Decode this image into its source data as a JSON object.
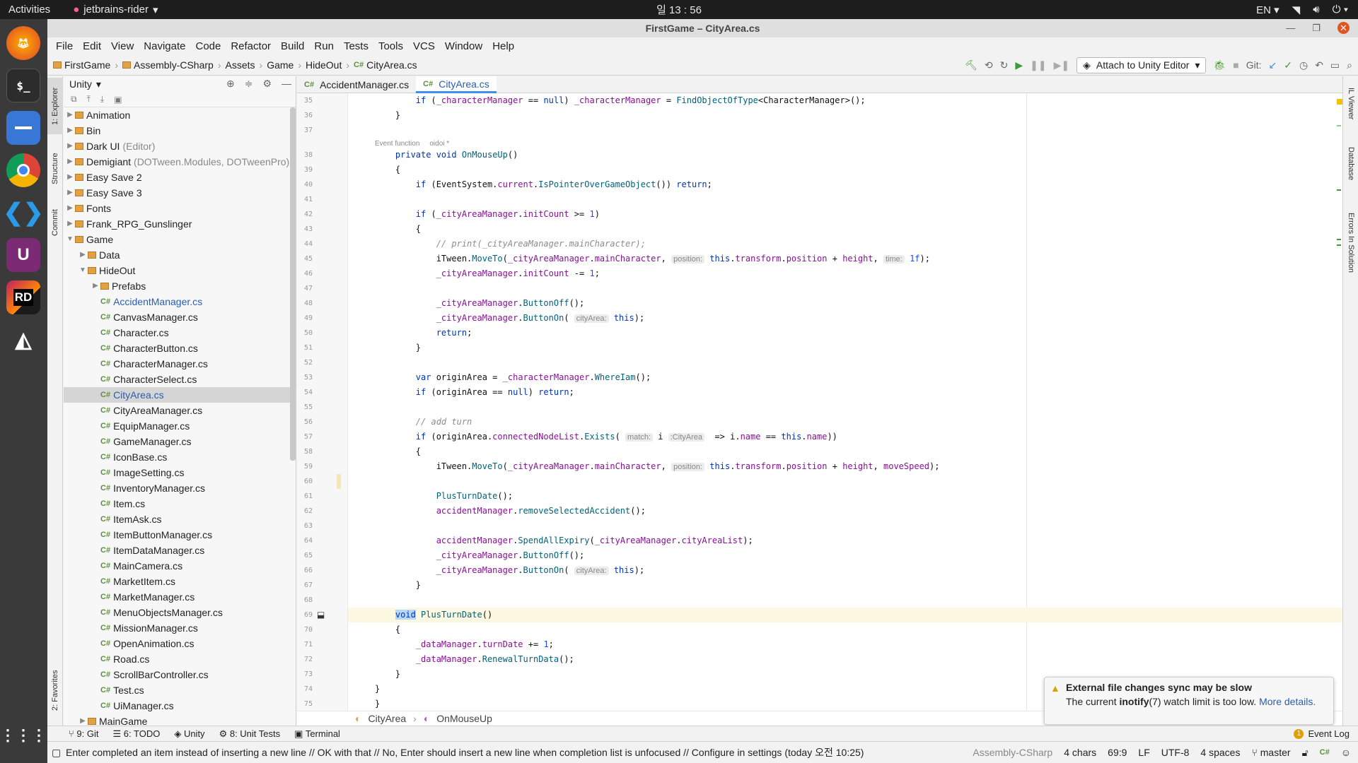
{
  "system": {
    "activities": "Activities",
    "app_name": "jetbrains-rider",
    "clock": "일 13 : 56",
    "lang": "EN"
  },
  "window": {
    "title": "FirstGame – CityArea.cs"
  },
  "menu": [
    "File",
    "Edit",
    "View",
    "Navigate",
    "Code",
    "Refactor",
    "Build",
    "Run",
    "Tests",
    "Tools",
    "VCS",
    "Window",
    "Help"
  ],
  "breadcrumb": [
    "FirstGame",
    "Assembly-CSharp",
    "Assets",
    "Game",
    "HideOut",
    "CityArea.cs"
  ],
  "toolbar": {
    "attach": "Attach to Unity Editor",
    "git": "Git:"
  },
  "left_tabs": [
    "1: Explorer",
    "Structure",
    "Commit",
    "2: Favorites"
  ],
  "right_tabs": [
    "IL Viewer",
    "Database",
    "Errors In Solution"
  ],
  "explorer": {
    "title": "Unity",
    "rows": [
      {
        "t": "Animation",
        "d": 0,
        "type": "folder",
        "arrow": "▶"
      },
      {
        "t": "Bin",
        "d": 0,
        "type": "folder",
        "arrow": "▶"
      },
      {
        "t": "Dark UI",
        "extra": "(Editor)",
        "d": 0,
        "type": "folder",
        "arrow": "▶"
      },
      {
        "t": "Demigiant",
        "extra": "(DOTween.Modules, DOTweenPro)",
        "d": 0,
        "type": "folder",
        "arrow": "▶"
      },
      {
        "t": "Easy Save 2",
        "d": 0,
        "type": "folder",
        "arrow": "▶"
      },
      {
        "t": "Easy Save 3",
        "d": 0,
        "type": "folder",
        "arrow": "▶"
      },
      {
        "t": "Fonts",
        "d": 0,
        "type": "folder",
        "arrow": "▶"
      },
      {
        "t": "Frank_RPG_Gunslinger",
        "d": 0,
        "type": "folder",
        "arrow": "▶"
      },
      {
        "t": "Game",
        "d": 0,
        "type": "folder",
        "arrow": "▼"
      },
      {
        "t": "Data",
        "d": 1,
        "type": "folder",
        "arrow": "▶"
      },
      {
        "t": "HideOut",
        "d": 1,
        "type": "folder",
        "arrow": "▼"
      },
      {
        "t": "Prefabs",
        "d": 2,
        "type": "folder",
        "arrow": "▶"
      },
      {
        "t": "AccidentManager.cs",
        "d": 2,
        "type": "cs",
        "blue": true
      },
      {
        "t": "CanvasManager.cs",
        "d": 2,
        "type": "cs"
      },
      {
        "t": "Character.cs",
        "d": 2,
        "type": "cs"
      },
      {
        "t": "CharacterButton.cs",
        "d": 2,
        "type": "cs"
      },
      {
        "t": "CharacterManager.cs",
        "d": 2,
        "type": "cs"
      },
      {
        "t": "CharacterSelect.cs",
        "d": 2,
        "type": "cs"
      },
      {
        "t": "CityArea.cs",
        "d": 2,
        "type": "cs",
        "blue": true,
        "selected": true
      },
      {
        "t": "CityAreaManager.cs",
        "d": 2,
        "type": "cs"
      },
      {
        "t": "EquipManager.cs",
        "d": 2,
        "type": "cs"
      },
      {
        "t": "GameManager.cs",
        "d": 2,
        "type": "cs"
      },
      {
        "t": "IconBase.cs",
        "d": 2,
        "type": "cs"
      },
      {
        "t": "ImageSetting.cs",
        "d": 2,
        "type": "cs"
      },
      {
        "t": "InventoryManager.cs",
        "d": 2,
        "type": "cs"
      },
      {
        "t": "Item.cs",
        "d": 2,
        "type": "cs"
      },
      {
        "t": "ItemAsk.cs",
        "d": 2,
        "type": "cs"
      },
      {
        "t": "ItemButtonManager.cs",
        "d": 2,
        "type": "cs"
      },
      {
        "t": "ItemDataManager.cs",
        "d": 2,
        "type": "cs"
      },
      {
        "t": "MainCamera.cs",
        "d": 2,
        "type": "cs"
      },
      {
        "t": "MarketItem.cs",
        "d": 2,
        "type": "cs"
      },
      {
        "t": "MarketManager.cs",
        "d": 2,
        "type": "cs"
      },
      {
        "t": "MenuObjectsManager.cs",
        "d": 2,
        "type": "cs"
      },
      {
        "t": "MissionManager.cs",
        "d": 2,
        "type": "cs"
      },
      {
        "t": "OpenAnimation.cs",
        "d": 2,
        "type": "cs"
      },
      {
        "t": "Road.cs",
        "d": 2,
        "type": "cs"
      },
      {
        "t": "ScrollBarController.cs",
        "d": 2,
        "type": "cs"
      },
      {
        "t": "Test.cs",
        "d": 2,
        "type": "cs"
      },
      {
        "t": "UiManager.cs",
        "d": 2,
        "type": "cs"
      },
      {
        "t": "MainGame",
        "d": 1,
        "type": "folder",
        "arrow": "▶"
      }
    ]
  },
  "tabs": [
    {
      "label": "AccidentManager.cs",
      "active": false
    },
    {
      "label": "CityArea.cs",
      "active": true
    }
  ],
  "code_hints": {
    "usage": "Event function",
    "author": "oidoi *"
  },
  "code": [
    {
      "n": "35",
      "h": "        <span class='kw'>if</span> (<span class='mem'>_characterManager</span> == <span class='kw'>null</span>) <span class='mem'>_characterManager</span> = <span class='fn'>FindObjectOfType</span>&lt;CharacterManager&gt;();"
    },
    {
      "n": "36",
      "h": "    }"
    },
    {
      "n": "37",
      "h": ""
    },
    {
      "n": "38",
      "h": "    <span class='kw'>private void</span> <span class='fn'>OnMouseUp</span>()"
    },
    {
      "n": "39",
      "h": "    {"
    },
    {
      "n": "40",
      "h": "        <span class='kw'>if</span> (EventSystem.<span class='mem'>current</span>.<span class='fn'>IsPointerOverGameObject</span>()) <span class='kw'>return</span>;"
    },
    {
      "n": "41",
      "h": ""
    },
    {
      "n": "42",
      "h": "        <span class='kw'>if</span> (<span class='mem'>_cityAreaManager</span>.<span class='mem'>initCount</span> &gt;= <span class='num'>1</span>)"
    },
    {
      "n": "43",
      "h": "        {"
    },
    {
      "n": "44",
      "h": "            <span class='cm'>// print(_cityAreaManager.mainCharacter);</span>"
    },
    {
      "n": "45",
      "h": "            iTween.<span class='fn'>MoveTo</span>(<span class='mem'>_cityAreaManager</span>.<span class='mem'>mainCharacter</span>, <span class='ih'>position:</span> <span class='kw'>this</span>.<span class='mem'>transform</span>.<span class='mem'>position</span> + <span class='mem'>height</span>, <span class='ih'>time:</span> <span class='num'>1f</span>);"
    },
    {
      "n": "46",
      "h": "            <span class='mem'>_cityAreaManager</span>.<span class='mem'>initCount</span> -= <span class='num'>1</span>;"
    },
    {
      "n": "47",
      "h": ""
    },
    {
      "n": "48",
      "h": "            <span class='mem'>_cityAreaManager</span>.<span class='fn'>ButtonOff</span>();"
    },
    {
      "n": "49",
      "h": "            <span class='mem'>_cityAreaManager</span>.<span class='fn'>ButtonOn</span>( <span class='ih'>cityArea:</span> <span class='kw'>this</span>);"
    },
    {
      "n": "50",
      "h": "            <span class='kw'>return</span>;"
    },
    {
      "n": "51",
      "h": "        }"
    },
    {
      "n": "52",
      "h": ""
    },
    {
      "n": "53",
      "h": "        <span class='kw'>var</span> originArea = <span class='mem'>_characterManager</span>.<span class='fn'>WhereIam</span>();"
    },
    {
      "n": "54",
      "h": "        <span class='kw'>if</span> (originArea == <span class='kw'>null</span>) <span class='kw'>return</span>;"
    },
    {
      "n": "55",
      "h": ""
    },
    {
      "n": "56",
      "h": "        <span class='cm'>// add turn</span>"
    },
    {
      "n": "57",
      "h": "        <span class='kw'>if</span> (originArea.<span class='mem'>connectedNodeList</span>.<span class='fn'>Exists</span>( <span class='ih'>match:</span> i <span class='ih'>:CityArea</span>  =&gt; i.<span class='mem'>name</span> == <span class='kw'>this</span>.<span class='mem'>name</span>))"
    },
    {
      "n": "58",
      "h": "        {"
    },
    {
      "n": "59",
      "h": "            iTween.<span class='fn'>MoveTo</span>(<span class='mem'>_cityAreaManager</span>.<span class='mem'>mainCharacter</span>, <span class='ih'>position:</span> <span class='kw'>this</span>.<span class='mem'>transform</span>.<span class='mem'>position</span> + <span class='mem'>height</span>, <span class='mem'>moveSpeed</span>);"
    },
    {
      "n": "60",
      "h": ""
    },
    {
      "n": "61",
      "h": "            <span class='fn'>PlusTurnDate</span>();"
    },
    {
      "n": "62",
      "h": "            <span class='mem'>accidentManager</span>.<span class='fn'>removeSelectedAccident</span>();"
    },
    {
      "n": "63",
      "h": ""
    },
    {
      "n": "64",
      "h": "            <span class='mem'>accidentManager</span>.<span class='fn'>SpendAllExpiry</span>(<span class='mem'>_cityAreaManager</span>.<span class='mem'>cityAreaList</span>);"
    },
    {
      "n": "65",
      "h": "            <span class='mem'>_cityAreaManager</span>.<span class='fn'>ButtonOff</span>();"
    },
    {
      "n": "66",
      "h": "            <span class='mem'>_cityAreaManager</span>.<span class='fn'>ButtonOn</span>( <span class='ih'>cityArea:</span> <span class='kw'>this</span>);"
    },
    {
      "n": "67",
      "h": "        }"
    },
    {
      "n": "68",
      "h": ""
    },
    {
      "n": "69",
      "h": "    <span class='kw' style='background:#b4d7ff'>void</span> <span class='fn'>PlusTurnDate</span>()"
    },
    {
      "n": "70",
      "h": "    {"
    },
    {
      "n": "71",
      "h": "        <span class='mem'>_dataManager</span>.<span class='mem'>turnDate</span> += <span class='num'>1</span>;"
    },
    {
      "n": "72",
      "h": "        <span class='mem'>_dataManager</span>.<span class='fn'>RenewalTurnData</span>();"
    },
    {
      "n": "73",
      "h": "    }"
    },
    {
      "n": "74",
      "h": "}"
    },
    {
      "n": "75",
      "h": "}"
    }
  ],
  "code_crumbs": [
    "CityArea",
    "OnMouseUp"
  ],
  "notification": {
    "title": "External file changes sync may be slow",
    "body_pre": "The current ",
    "body_bold": "inotify",
    "body_post": "(7) watch limit is too low.",
    "link": "More details."
  },
  "bottom_tools": [
    "9: Git",
    "6: TODO",
    "Unity",
    "8: Unit Tests",
    "Terminal"
  ],
  "event_log": {
    "count": "1",
    "label": "Event Log"
  },
  "status": {
    "message": "Enter completed an item instead of inserting a new line // OK with that // No, Enter should insert a new line when completion list is unfocused // Configure in settings (today 오전 10:25)",
    "project": "Assembly-CSharp",
    "chars": "4 chars",
    "pos": "69:9",
    "lf": "LF",
    "enc": "UTF-8",
    "indent": "4 spaces",
    "branch": "master"
  }
}
